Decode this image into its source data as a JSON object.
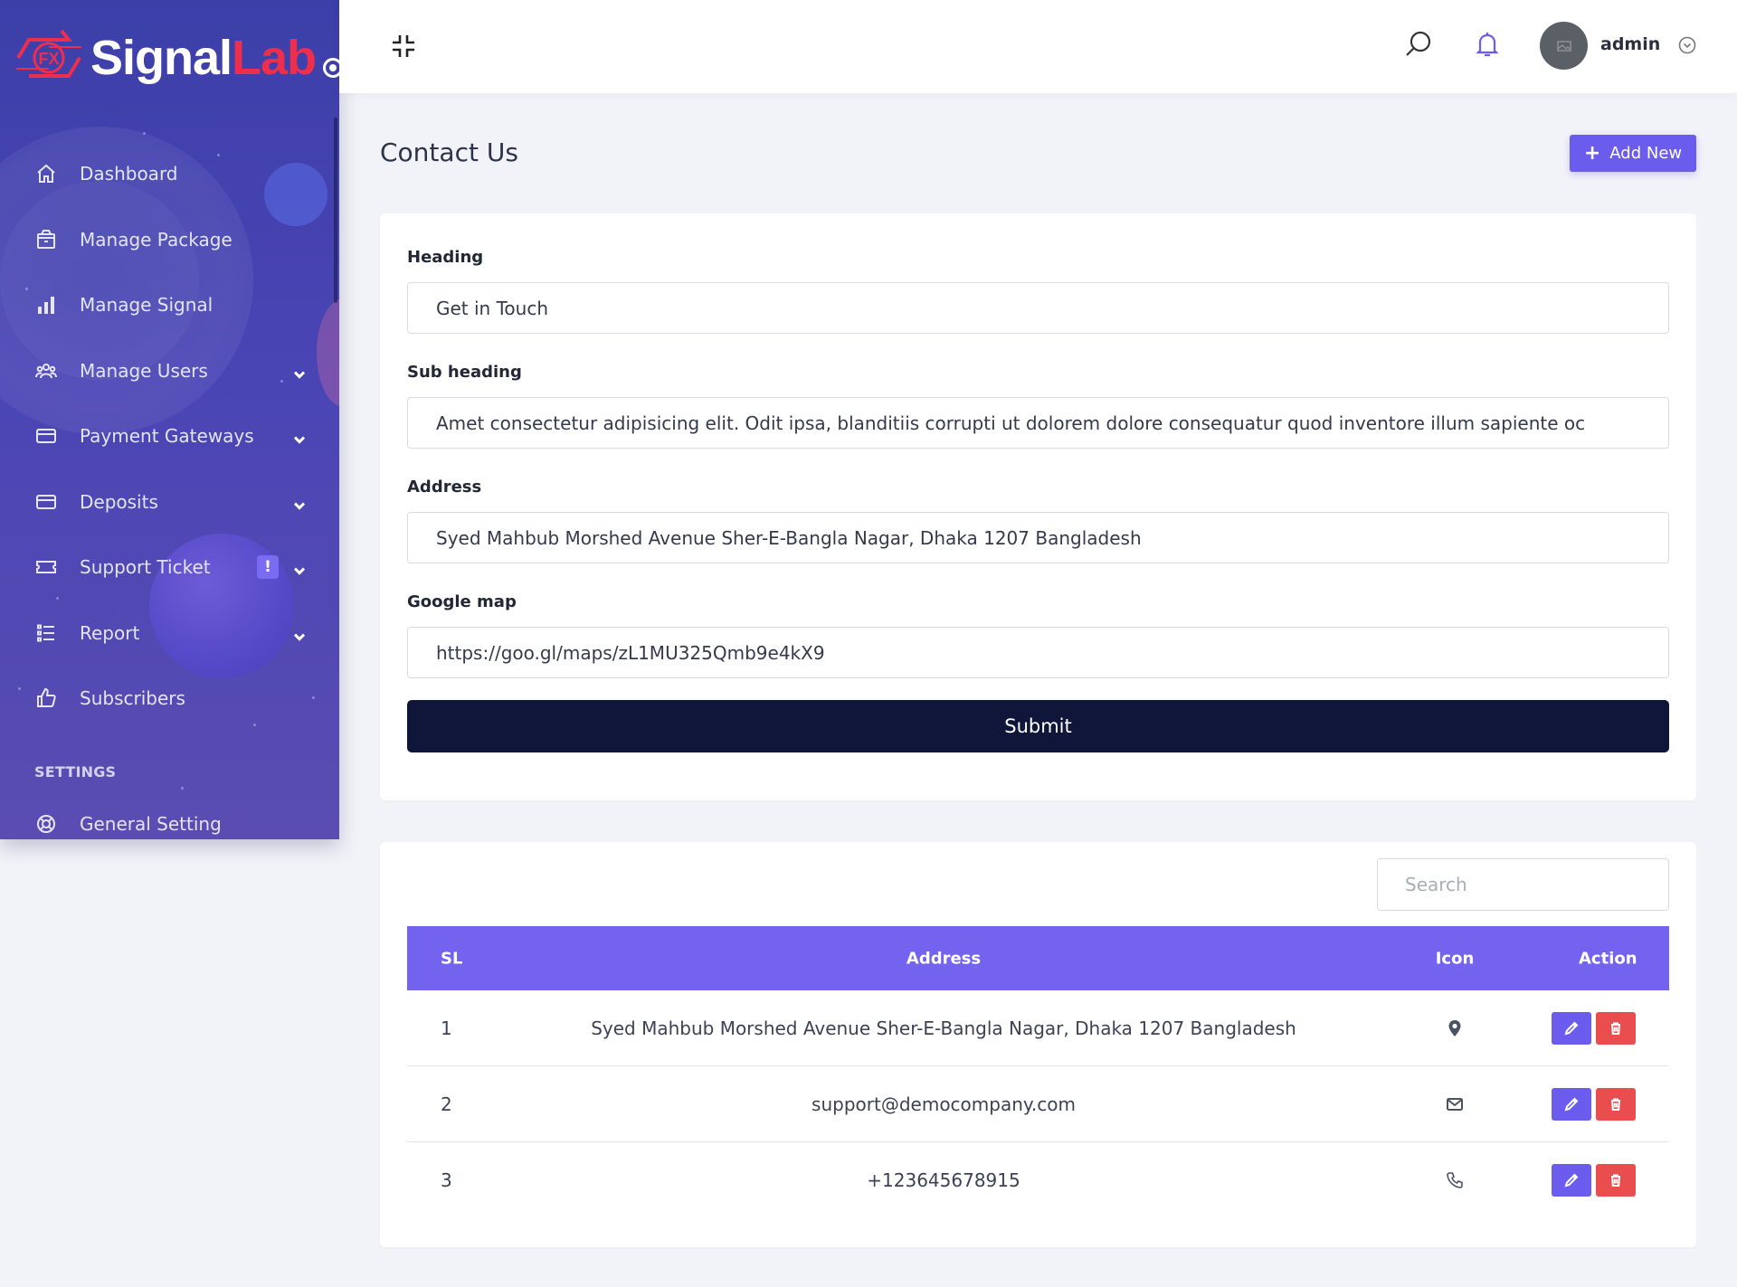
{
  "brand": {
    "part1": "Signal",
    "part2": "Lab",
    "mark_text": "FX"
  },
  "colors": {
    "accent": "#6c5ced",
    "sidebar": "#4544b0",
    "submit": "#10163a",
    "danger": "#ea4d4d",
    "brand_red": "#ee2f4b"
  },
  "sidebar": {
    "items": [
      {
        "label": "Dashboard",
        "icon": "home-icon"
      },
      {
        "label": "Manage Package",
        "icon": "package-icon"
      },
      {
        "label": "Manage Signal",
        "icon": "bar-chart-icon"
      },
      {
        "label": "Manage Users",
        "icon": "users-icon",
        "has_submenu": true
      },
      {
        "label": "Payment Gateways",
        "icon": "credit-card-icon",
        "has_submenu": true
      },
      {
        "label": "Deposits",
        "icon": "credit-card-icon",
        "has_submenu": true
      },
      {
        "label": "Support Ticket",
        "icon": "ticket-icon",
        "has_submenu": true,
        "badge": "!"
      },
      {
        "label": "Report",
        "icon": "list-icon",
        "has_submenu": true
      },
      {
        "label": "Subscribers",
        "icon": "thumbs-up-icon"
      }
    ],
    "settings_title": "SETTINGS",
    "settings_items": [
      {
        "label": "General Setting",
        "icon": "lifebuoy-icon"
      }
    ]
  },
  "topbar": {
    "user_name": "admin"
  },
  "page": {
    "title": "Contact Us",
    "add_new_label": "Add New"
  },
  "form": {
    "heading_label": "Heading",
    "heading_value": "Get in Touch",
    "subheading_label": "Sub heading",
    "subheading_value": "Amet consectetur adipisicing elit. Odit ipsa, blanditiis corrupti ut dolorem dolore consequatur quod inventore illum sapiente oc",
    "address_label": "Address",
    "address_value": "Syed Mahbub Morshed Avenue Sher-E-Bangla Nagar, Dhaka 1207 Bangladesh",
    "map_label": "Google map",
    "map_value": "https://goo.gl/maps/zL1MU325Qmb9e4kX9",
    "submit_label": "Submit"
  },
  "table": {
    "search_placeholder": "Search",
    "headers": {
      "sl": "SL",
      "address": "Address",
      "icon": "Icon",
      "action": "Action"
    },
    "rows": [
      {
        "sl": "1",
        "address": "Syed Mahbub Morshed Avenue Sher-E-Bangla Nagar, Dhaka 1207 Bangladesh",
        "icon": "map-marker-icon"
      },
      {
        "sl": "2",
        "address": "support@democompany.com",
        "icon": "envelope-icon"
      },
      {
        "sl": "3",
        "address": "+123645678915",
        "icon": "phone-icon"
      }
    ]
  }
}
